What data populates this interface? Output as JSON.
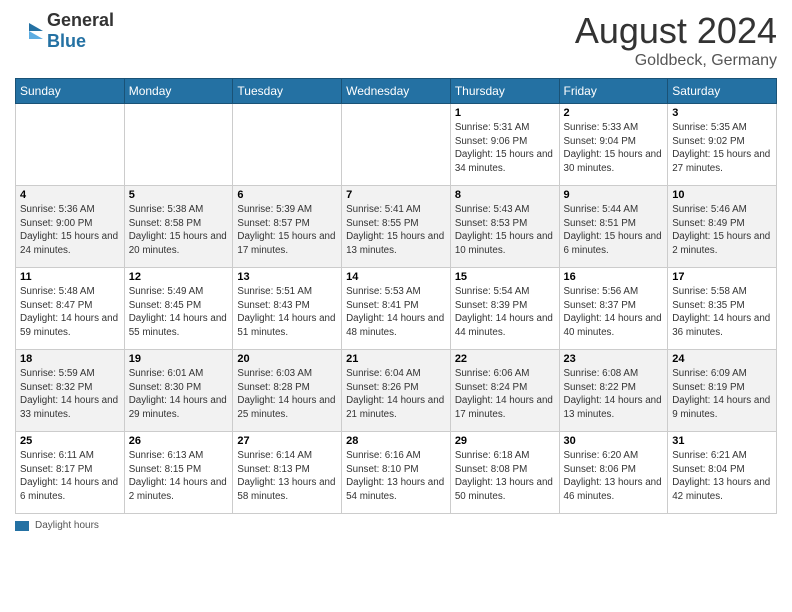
{
  "header": {
    "logo_general": "General",
    "logo_blue": "Blue",
    "month_year": "August 2024",
    "location": "Goldbeck, Germany"
  },
  "weekdays": [
    "Sunday",
    "Monday",
    "Tuesday",
    "Wednesday",
    "Thursday",
    "Friday",
    "Saturday"
  ],
  "weeks": [
    [
      {
        "day": "",
        "info": ""
      },
      {
        "day": "",
        "info": ""
      },
      {
        "day": "",
        "info": ""
      },
      {
        "day": "",
        "info": ""
      },
      {
        "day": "1",
        "info": "Sunrise: 5:31 AM\nSunset: 9:06 PM\nDaylight: 15 hours and 34 minutes."
      },
      {
        "day": "2",
        "info": "Sunrise: 5:33 AM\nSunset: 9:04 PM\nDaylight: 15 hours and 30 minutes."
      },
      {
        "day": "3",
        "info": "Sunrise: 5:35 AM\nSunset: 9:02 PM\nDaylight: 15 hours and 27 minutes."
      }
    ],
    [
      {
        "day": "4",
        "info": "Sunrise: 5:36 AM\nSunset: 9:00 PM\nDaylight: 15 hours and 24 minutes."
      },
      {
        "day": "5",
        "info": "Sunrise: 5:38 AM\nSunset: 8:58 PM\nDaylight: 15 hours and 20 minutes."
      },
      {
        "day": "6",
        "info": "Sunrise: 5:39 AM\nSunset: 8:57 PM\nDaylight: 15 hours and 17 minutes."
      },
      {
        "day": "7",
        "info": "Sunrise: 5:41 AM\nSunset: 8:55 PM\nDaylight: 15 hours and 13 minutes."
      },
      {
        "day": "8",
        "info": "Sunrise: 5:43 AM\nSunset: 8:53 PM\nDaylight: 15 hours and 10 minutes."
      },
      {
        "day": "9",
        "info": "Sunrise: 5:44 AM\nSunset: 8:51 PM\nDaylight: 15 hours and 6 minutes."
      },
      {
        "day": "10",
        "info": "Sunrise: 5:46 AM\nSunset: 8:49 PM\nDaylight: 15 hours and 2 minutes."
      }
    ],
    [
      {
        "day": "11",
        "info": "Sunrise: 5:48 AM\nSunset: 8:47 PM\nDaylight: 14 hours and 59 minutes."
      },
      {
        "day": "12",
        "info": "Sunrise: 5:49 AM\nSunset: 8:45 PM\nDaylight: 14 hours and 55 minutes."
      },
      {
        "day": "13",
        "info": "Sunrise: 5:51 AM\nSunset: 8:43 PM\nDaylight: 14 hours and 51 minutes."
      },
      {
        "day": "14",
        "info": "Sunrise: 5:53 AM\nSunset: 8:41 PM\nDaylight: 14 hours and 48 minutes."
      },
      {
        "day": "15",
        "info": "Sunrise: 5:54 AM\nSunset: 8:39 PM\nDaylight: 14 hours and 44 minutes."
      },
      {
        "day": "16",
        "info": "Sunrise: 5:56 AM\nSunset: 8:37 PM\nDaylight: 14 hours and 40 minutes."
      },
      {
        "day": "17",
        "info": "Sunrise: 5:58 AM\nSunset: 8:35 PM\nDaylight: 14 hours and 36 minutes."
      }
    ],
    [
      {
        "day": "18",
        "info": "Sunrise: 5:59 AM\nSunset: 8:32 PM\nDaylight: 14 hours and 33 minutes."
      },
      {
        "day": "19",
        "info": "Sunrise: 6:01 AM\nSunset: 8:30 PM\nDaylight: 14 hours and 29 minutes."
      },
      {
        "day": "20",
        "info": "Sunrise: 6:03 AM\nSunset: 8:28 PM\nDaylight: 14 hours and 25 minutes."
      },
      {
        "day": "21",
        "info": "Sunrise: 6:04 AM\nSunset: 8:26 PM\nDaylight: 14 hours and 21 minutes."
      },
      {
        "day": "22",
        "info": "Sunrise: 6:06 AM\nSunset: 8:24 PM\nDaylight: 14 hours and 17 minutes."
      },
      {
        "day": "23",
        "info": "Sunrise: 6:08 AM\nSunset: 8:22 PM\nDaylight: 14 hours and 13 minutes."
      },
      {
        "day": "24",
        "info": "Sunrise: 6:09 AM\nSunset: 8:19 PM\nDaylight: 14 hours and 9 minutes."
      }
    ],
    [
      {
        "day": "25",
        "info": "Sunrise: 6:11 AM\nSunset: 8:17 PM\nDaylight: 14 hours and 6 minutes."
      },
      {
        "day": "26",
        "info": "Sunrise: 6:13 AM\nSunset: 8:15 PM\nDaylight: 14 hours and 2 minutes."
      },
      {
        "day": "27",
        "info": "Sunrise: 6:14 AM\nSunset: 8:13 PM\nDaylight: 13 hours and 58 minutes."
      },
      {
        "day": "28",
        "info": "Sunrise: 6:16 AM\nSunset: 8:10 PM\nDaylight: 13 hours and 54 minutes."
      },
      {
        "day": "29",
        "info": "Sunrise: 6:18 AM\nSunset: 8:08 PM\nDaylight: 13 hours and 50 minutes."
      },
      {
        "day": "30",
        "info": "Sunrise: 6:20 AM\nSunset: 8:06 PM\nDaylight: 13 hours and 46 minutes."
      },
      {
        "day": "31",
        "info": "Sunrise: 6:21 AM\nSunset: 8:04 PM\nDaylight: 13 hours and 42 minutes."
      }
    ]
  ],
  "footer": {
    "legend_label": "Daylight hours"
  }
}
